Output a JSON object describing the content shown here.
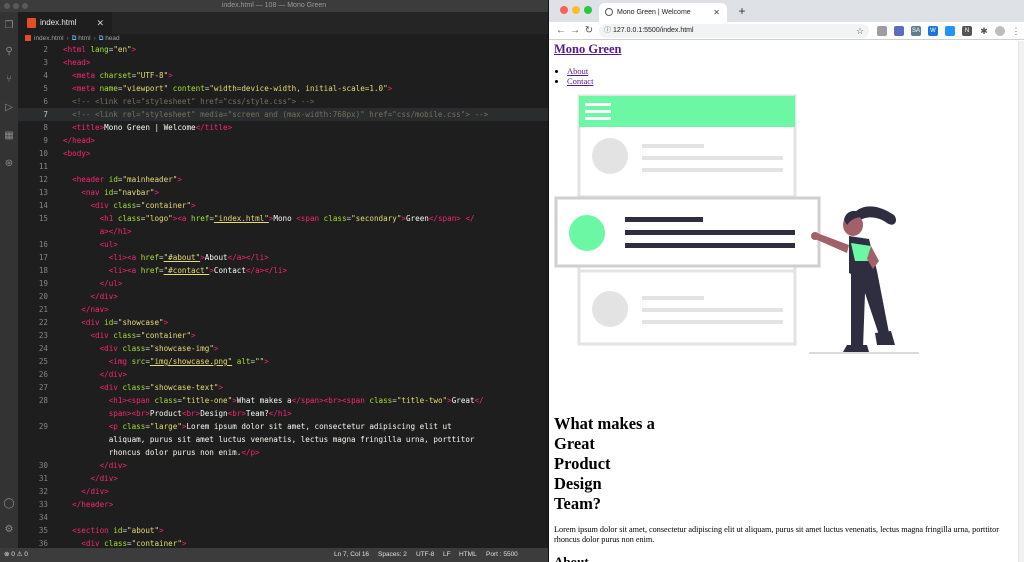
{
  "vscode": {
    "window_title": "index.html — 108 — Mono Green",
    "tab_label": "index.html",
    "breadcrumb": [
      "index.html",
      "html",
      "head"
    ],
    "status": {
      "problems": "⊗ 0 ⚠ 0",
      "position": "Ln 7, Col 16",
      "spaces": "Spaces: 2",
      "encoding": "UTF-8",
      "eol": "LF",
      "language": "HTML",
      "port": "Port : 5500"
    },
    "line_numbers": [
      "2",
      "3",
      "4",
      "5",
      "6",
      "7",
      "8",
      "9",
      "10",
      "11",
      "12",
      "13",
      "14",
      "15",
      "",
      "16",
      "17",
      "18",
      "19",
      "20",
      "21",
      "22",
      "23",
      "24",
      "25",
      "26",
      "27",
      "28",
      "",
      "29",
      "",
      "",
      "30",
      "31",
      "32",
      "33",
      "34",
      "35",
      "36"
    ]
  },
  "browser": {
    "tab_title": "Mono Green | Welcome",
    "url": "127.0.0.1:5500/index.html",
    "logo": "Mono Green",
    "nav": [
      "About",
      "Contact"
    ],
    "title_lines": [
      "What makes a",
      "Great",
      "Product",
      "Design",
      "Team?"
    ],
    "paragraph": "Lorem ipsum dolor sit amet, consectetur adipiscing elit ut aliquam, purus sit amet luctus venenatis, lectus magna fringilla urna, porttitor rhoncus dolor purus non enim.",
    "next_heading": "About",
    "extensions": [
      "SA",
      "W",
      "N"
    ]
  },
  "colors": {
    "accent": "#6cf7a5",
    "card_border": "#e0e0e0",
    "person_dark": "#2f2e41"
  }
}
